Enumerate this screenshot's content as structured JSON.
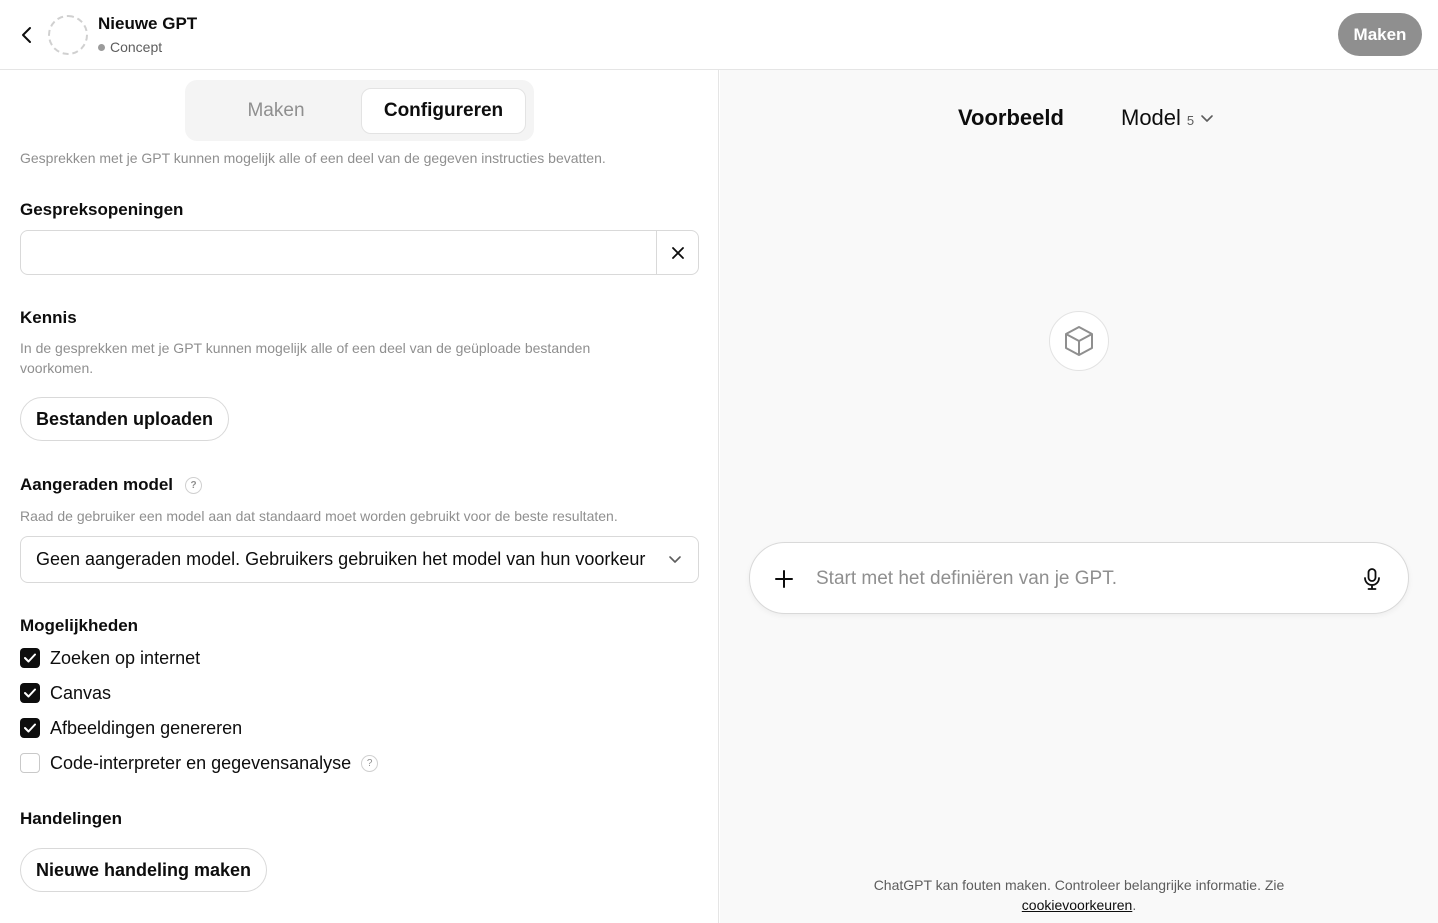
{
  "header": {
    "title": "Nieuwe GPT",
    "status": "Concept",
    "create_label": "Maken"
  },
  "tabs": {
    "make": "Maken",
    "configure": "Configureren",
    "active": "configure"
  },
  "left": {
    "instructions_hint": "Gesprekken met je GPT kunnen mogelijk alle of een deel van de gegeven instructies bevatten.",
    "conversation_starters": {
      "title": "Gespreksopeningen",
      "value": ""
    },
    "knowledge": {
      "title": "Kennis",
      "hint": "In de gesprekken met je GPT kunnen mogelijk alle of een deel van de geüploade bestanden voorkomen.",
      "upload_label": "Bestanden uploaden"
    },
    "recommended_model": {
      "title": "Aangeraden model",
      "help": "?",
      "hint": "Raad de gebruiker een model aan dat standaard moet worden gebruikt voor de beste resultaten.",
      "selected": "Geen aangeraden model. Gebruikers gebruiken het model van hun voorkeur"
    },
    "capabilities": {
      "title": "Mogelijkheden",
      "items": [
        {
          "label": "Zoeken op internet",
          "checked": true
        },
        {
          "label": "Canvas",
          "checked": true
        },
        {
          "label": "Afbeeldingen genereren",
          "checked": true
        },
        {
          "label": "Code-interpreter en gegevensanalyse",
          "checked": false,
          "help": "?"
        }
      ]
    },
    "actions": {
      "title": "Handelingen",
      "new_action_label": "Nieuwe handeling maken"
    }
  },
  "preview": {
    "title": "Voorbeeld",
    "model_label": "Model",
    "model_version": "5",
    "composer_placeholder": "Start met het definiëren van je GPT.",
    "footer_text": "ChatGPT kan fouten maken. Controleer belangrijke informatie. Zie",
    "footer_link": "cookievoorkeuren",
    "footer_end": "."
  }
}
